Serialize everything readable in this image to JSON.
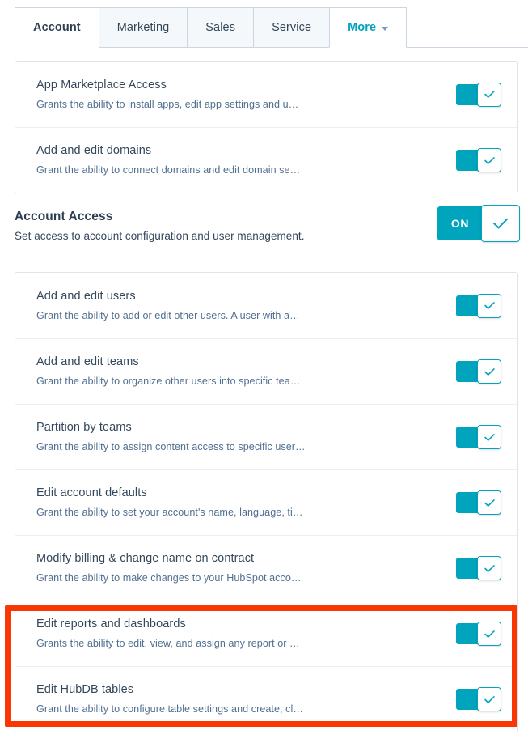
{
  "tabs": [
    {
      "label": "Account",
      "state": "active"
    },
    {
      "label": "Marketing",
      "state": "inactive"
    },
    {
      "label": "Sales",
      "state": "inactive"
    },
    {
      "label": "Service",
      "state": "inactive"
    },
    {
      "label": "More",
      "state": "dropdown"
    }
  ],
  "colors": {
    "accent_teal": "#00A4BD",
    "heading_text": "#33475B",
    "body_text": "#516F90",
    "card_border": "#DFE3EB",
    "tab_inactive_bg": "#F5F8FA",
    "annotation_red": "#FA3604"
  },
  "top_card": {
    "rows": [
      {
        "title": "App Marketplace Access",
        "description": "Grants the ability to install apps, edit app settings and u…",
        "toggle": {
          "state": "on",
          "icon": "check-icon"
        }
      },
      {
        "title": "Add and edit domains",
        "description": "Grant the ability to connect domains and edit domain se…",
        "toggle": {
          "state": "on",
          "icon": "check-icon"
        }
      }
    ]
  },
  "account_access_section": {
    "title": "Account Access",
    "description": "Set access to account configuration and user management.",
    "master_toggle": {
      "state": "on",
      "label": "ON",
      "icon": "check-icon"
    },
    "rows": [
      {
        "title": "Add and edit users",
        "description": "Grant the ability to add or edit other users. A user with a…",
        "toggle": {
          "state": "on",
          "icon": "check-icon"
        }
      },
      {
        "title": "Add and edit teams",
        "description": "Grant the ability to organize other users into specific tea…",
        "toggle": {
          "state": "on",
          "icon": "check-icon"
        }
      },
      {
        "title": "Partition by teams",
        "description": "Grant the ability to assign content access to specific user…",
        "toggle": {
          "state": "on",
          "icon": "check-icon"
        }
      },
      {
        "title": "Edit account defaults",
        "description": "Grant the ability to set your account's name, language, ti…",
        "toggle": {
          "state": "on",
          "icon": "check-icon"
        }
      },
      {
        "title": "Modify billing & change name on contract",
        "description": "Grant the ability to make changes to your HubSpot acco…",
        "toggle": {
          "state": "on",
          "icon": "check-icon"
        }
      },
      {
        "title": "Edit reports and dashboards",
        "description": "Grants the ability to edit, view, and assign any report or …",
        "toggle": {
          "state": "on",
          "icon": "check-icon"
        },
        "highlighted": true
      },
      {
        "title": "Edit HubDB tables",
        "description": "Grant the ability to configure table settings and create, cl…",
        "toggle": {
          "state": "on",
          "icon": "check-icon"
        },
        "highlighted": true
      }
    ]
  },
  "annotation": {
    "shape": "rectangle",
    "color": "#FA3604",
    "covers": [
      "Edit reports and dashboards",
      "Edit HubDB tables"
    ]
  }
}
